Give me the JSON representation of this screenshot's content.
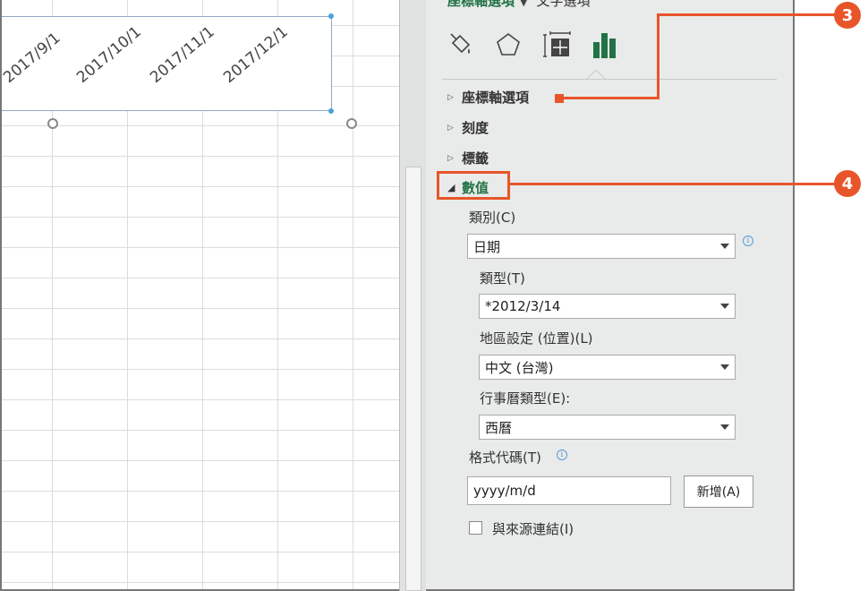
{
  "axis_labels": [
    "2017/9/1",
    "2017/10/1",
    "2017/11/1",
    "2017/12/1"
  ],
  "pane": {
    "tab_axis_options": "座標軸選項",
    "tab_text_options": "文字選項",
    "icons": [
      "fill-line-icon",
      "effects-pentagon-icon",
      "size-properties-icon",
      "axis-options-bar-chart-icon"
    ],
    "sections": {
      "axis_options": "座標軸選項",
      "tick_marks": "刻度",
      "labels": "標籤",
      "number": "數值"
    },
    "category_label": "類別(C)",
    "category_value": "日期",
    "type_label": "類型(T)",
    "type_value": "*2012/3/14",
    "locale_label": "地區設定 (位置)(L)",
    "locale_value": "中文 (台灣)",
    "calendar_label": "行事曆類型(E):",
    "calendar_value": "西曆",
    "format_code_label": "格式代碼(T)",
    "format_code_value": "yyyy/m/d",
    "add_button": "新增(A)",
    "link_to_source": "與來源連結(I)"
  },
  "callouts": [
    "3",
    "4"
  ],
  "colors": {
    "accent_green": "#217346",
    "callout_orange": "#e8552a",
    "pane_bg": "#e8ebe9"
  }
}
